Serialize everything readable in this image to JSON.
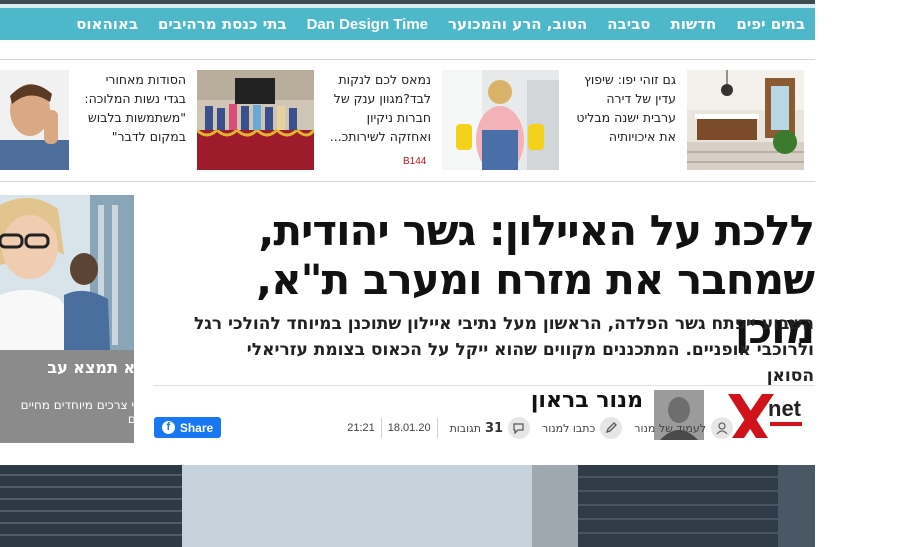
{
  "nav": {
    "items": [
      {
        "label": "בתים יפים"
      },
      {
        "label": "חדשות"
      },
      {
        "label": "סביבה"
      },
      {
        "label": "הטוב, הרע והמכוער"
      },
      {
        "label": "Dan Design Time"
      },
      {
        "label": "בתי כנסת מרהיבים"
      },
      {
        "label": "באוהאוס"
      }
    ]
  },
  "teasers": [
    {
      "lines": [
        "גם זוהי יפו: שיפוץ",
        "עדין של דירה",
        "ערבית ישנה מבליט",
        "את איכויותיה"
      ]
    },
    {
      "lines": [
        "נמאס לכם לנקות",
        "לבד?מגוון ענק של",
        "חברות ניקיון",
        "ואחזקה לשירותכ..."
      ],
      "tag": "B144"
    },
    {
      "lines": [
        "הסודות מאחורי",
        "בגדי נשות המלוכה:",
        "\"משתמשות בלבוש",
        "במקום לדבר\""
      ]
    }
  ],
  "article": {
    "headline_line1": "ללכת על האיילון: גשר יהודית,",
    "headline_line2": "שמחבר את מזרח ומערב ת\"א, מוכן",
    "subhead_line1": "השבוע ייפתח גשר הפלדה, הראשון מעל נתיבי איילון שתוכנן במיוחד להולכי רגל",
    "subhead_line2": "ולרוכבי אופניים. המתכננים מקווים שהוא ייקל על הכאוס בצומת עזריאלי הסואן",
    "author": "מנור בראון",
    "author_page": "לעמוד של מנור",
    "write_to": "כתבו למנור",
    "comments_count": "31",
    "comments_label": "תגובות",
    "date": "18.01.20",
    "time": "21:21",
    "share_label": "Share",
    "logo_text": "net"
  },
  "ad": {
    "title": "איך היא תמצא עב",
    "text": "כך בעלי צרכים מיוחדים מחיים עצמאיים"
  },
  "colors": {
    "nav_bg": "#4cb8c9",
    "logo_red": "#d0121b",
    "fb_blue": "#1877f2"
  }
}
